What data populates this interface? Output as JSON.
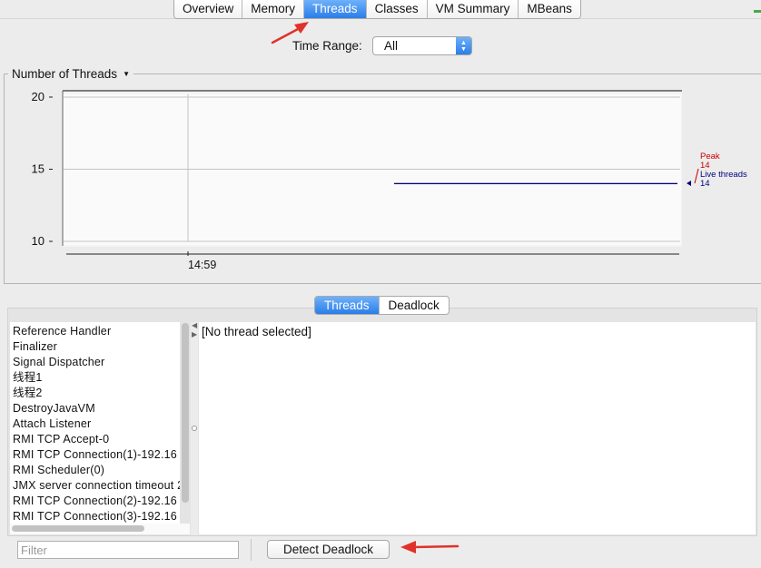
{
  "top_tabs": {
    "overview": "Overview",
    "memory": "Memory",
    "threads": "Threads",
    "classes": "Classes",
    "vm_summary": "VM Summary",
    "mbeans": "MBeans",
    "active": "Threads"
  },
  "time_range": {
    "label": "Time Range:",
    "value": "All"
  },
  "chart": {
    "title": "Number of Threads"
  },
  "chart_data": {
    "type": "line",
    "yticks": [
      "10",
      "15",
      "20"
    ],
    "ylim": [
      10,
      20
    ],
    "xticks": [
      "14:59"
    ],
    "series": [
      {
        "name": "Peak",
        "latest": 14,
        "color": "#cc0000"
      },
      {
        "name": "Live threads",
        "latest": 14,
        "color": "#000080"
      }
    ],
    "legend": [
      {
        "label": "Peak",
        "value": "14",
        "color": "#cc0000"
      },
      {
        "label": "Live threads",
        "value": "14",
        "color": "#000080"
      }
    ]
  },
  "bottom_tabs": {
    "threads": "Threads",
    "deadlock": "Deadlock"
  },
  "thread_list": [
    "Reference Handler",
    "Finalizer",
    "Signal Dispatcher",
    "线程1",
    "线程2",
    "DestroyJavaVM",
    "Attach Listener",
    "RMI TCP Accept-0",
    "RMI TCP Connection(1)-192.16",
    "RMI Scheduler(0)",
    "JMX server connection timeout 2",
    "RMI TCP Connection(2)-192.16",
    "RMI TCP Connection(3)-192.16"
  ],
  "detail": {
    "text": "[No thread selected]"
  },
  "filter": {
    "placeholder": "Filter"
  },
  "detect_button": {
    "label": "Detect Deadlock"
  },
  "colors": {
    "accent": "#2a7de9",
    "annotation_arrow": "#e0322a"
  }
}
